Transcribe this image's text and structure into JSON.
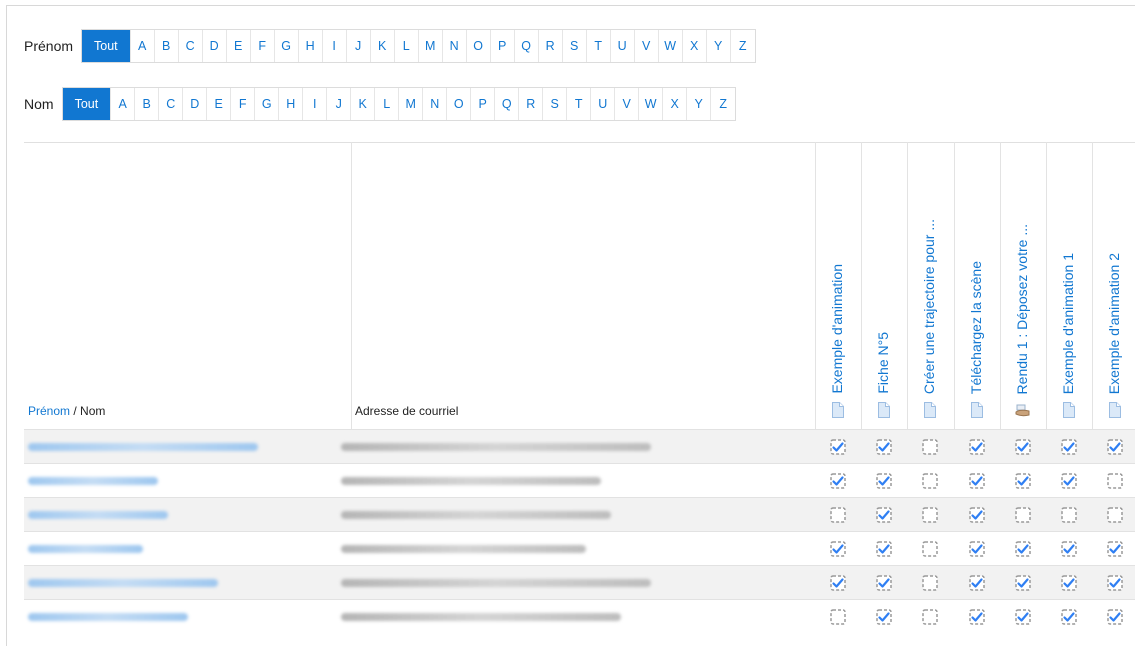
{
  "filters": {
    "firstname": {
      "label": "Prénom",
      "all": "Tout",
      "letters": [
        "A",
        "B",
        "C",
        "D",
        "E",
        "F",
        "G",
        "H",
        "I",
        "J",
        "K",
        "L",
        "M",
        "N",
        "O",
        "P",
        "Q",
        "R",
        "S",
        "T",
        "U",
        "V",
        "W",
        "X",
        "Y",
        "Z"
      ]
    },
    "lastname": {
      "label": "Nom",
      "all": "Tout",
      "letters": [
        "A",
        "B",
        "C",
        "D",
        "E",
        "F",
        "G",
        "H",
        "I",
        "J",
        "K",
        "L",
        "M",
        "N",
        "O",
        "P",
        "Q",
        "R",
        "S",
        "T",
        "U",
        "V",
        "W",
        "X",
        "Y",
        "Z"
      ]
    }
  },
  "table": {
    "header_firstname": "Prénom",
    "header_sep": " / ",
    "header_lastname": "Nom",
    "header_email": "Adresse de courriel",
    "activities": [
      {
        "label": "Exemple d'animation",
        "icon": "page-icon"
      },
      {
        "label": "Fiche N°5",
        "icon": "page-icon"
      },
      {
        "label": "Créer une trajectoire pour ...",
        "icon": "page-icon"
      },
      {
        "label": "Téléchargez la scène",
        "icon": "page-icon"
      },
      {
        "label": "Rendu 1 : Déposez votre ...",
        "icon": "assignment-hand-icon"
      },
      {
        "label": "Exemple d'animation 1",
        "icon": "page-icon"
      },
      {
        "label": "Exemple d'animation 2",
        "icon": "page-icon"
      }
    ],
    "rows": [
      {
        "completion": [
          1,
          1,
          0,
          1,
          1,
          1,
          1
        ]
      },
      {
        "completion": [
          1,
          1,
          0,
          1,
          1,
          1,
          0
        ]
      },
      {
        "completion": [
          0,
          1,
          0,
          1,
          0,
          0,
          0
        ]
      },
      {
        "completion": [
          1,
          1,
          0,
          1,
          1,
          1,
          1
        ]
      },
      {
        "completion": [
          1,
          1,
          0,
          1,
          1,
          1,
          1
        ]
      },
      {
        "completion": [
          0,
          1,
          0,
          1,
          1,
          1,
          1
        ]
      }
    ]
  },
  "colors": {
    "accent": "#1177d1",
    "check": "#2f7ff3",
    "box": "#9a9a9a"
  }
}
